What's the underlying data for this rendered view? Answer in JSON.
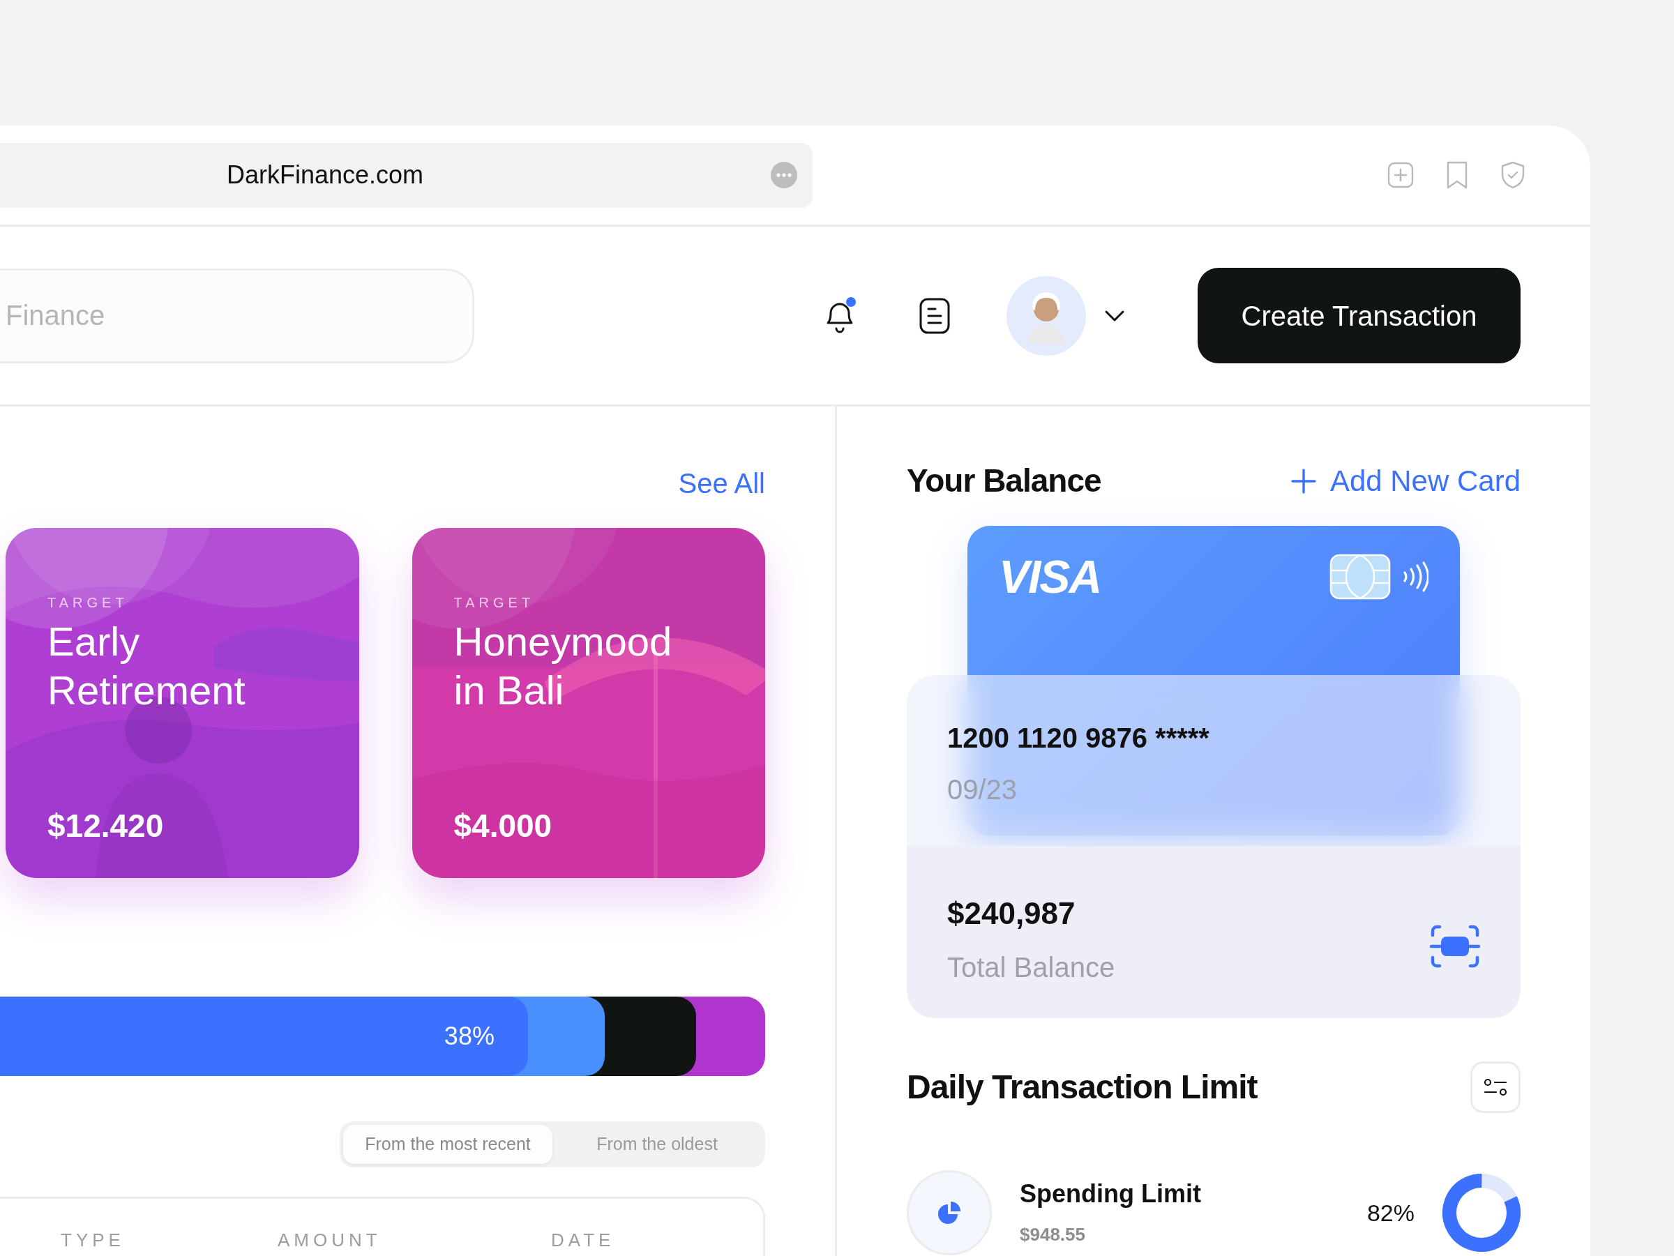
{
  "browser": {
    "url": "DarkFinance.com"
  },
  "search": {
    "placeholder": "Finance"
  },
  "header": {
    "notification_unread": true,
    "create_button": "Create Transaction"
  },
  "goals": {
    "see_all": "See All",
    "cards": [
      {
        "label": "TARGET",
        "title_lines": [
          "Early",
          "Retirement"
        ],
        "amount": "$12.420",
        "color": "#ae3fd2",
        "kind": "person"
      },
      {
        "label": "TARGET",
        "title_lines": [
          "Honeymood",
          "in Bali"
        ],
        "amount": "$4.000",
        "color": "#d33aa9",
        "kind": "umbrella"
      }
    ]
  },
  "allocation_bar": {
    "segments": [
      {
        "label": "38%",
        "color": "#3b71fe",
        "level": 0.69
      },
      {
        "color": "#4a8ffe",
        "level": 0.79
      },
      {
        "color": "#101511",
        "level": 0.91
      },
      {
        "color": "#b035cf"
      }
    ]
  },
  "sort_options": [
    {
      "label": "From the most recent",
      "selected": true
    },
    {
      "label": "From the oldest",
      "selected": false
    }
  ],
  "table": {
    "columns": [
      "TYPE",
      "AMOUNT",
      "DATE"
    ]
  },
  "balance": {
    "title": "Your Balance",
    "add_card": "Add New Card",
    "card": {
      "brand": "VISA",
      "number": "1200 1120 9876 *****",
      "expiry": "09/23"
    },
    "amount": "$240,987",
    "amount_label": "Total Balance"
  },
  "daily_limit": {
    "title": "Daily Transaction Limit",
    "items": [
      {
        "name": "Spending Limit",
        "amount": "$948.55",
        "reading": "82%",
        "level": 0.82
      }
    ]
  }
}
